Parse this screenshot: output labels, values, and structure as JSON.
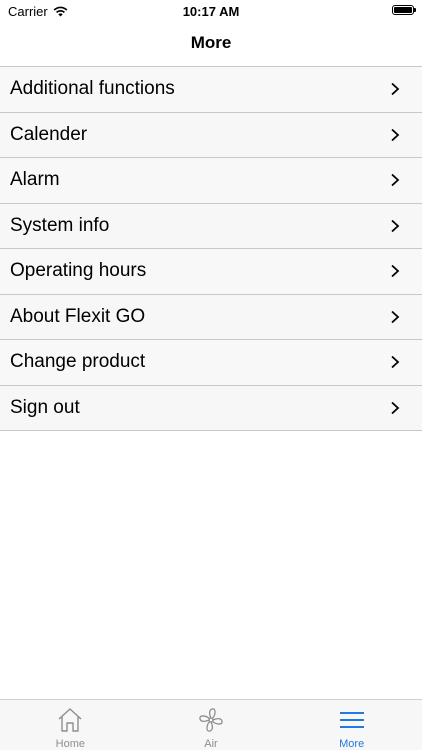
{
  "status_bar": {
    "carrier": "Carrier",
    "time": "10:17 AM"
  },
  "header": {
    "title": "More"
  },
  "menu": {
    "items": [
      {
        "label": "Additional functions"
      },
      {
        "label": "Calender"
      },
      {
        "label": "Alarm"
      },
      {
        "label": "System info"
      },
      {
        "label": "Operating hours"
      },
      {
        "label": "About Flexit GO"
      },
      {
        "label": "Change product"
      },
      {
        "label": "Sign out"
      }
    ]
  },
  "tabs": [
    {
      "label": "Home",
      "icon": "home-icon"
    },
    {
      "label": "Air",
      "icon": "fan-icon"
    },
    {
      "label": "More",
      "icon": "hamburger-menu-icon",
      "active": true
    }
  ],
  "colors": {
    "accent": "#1e7be0",
    "inactive_tab": "#8e8e8e",
    "row_background": "#f7f7f7",
    "separator": "#c8c8c8"
  }
}
